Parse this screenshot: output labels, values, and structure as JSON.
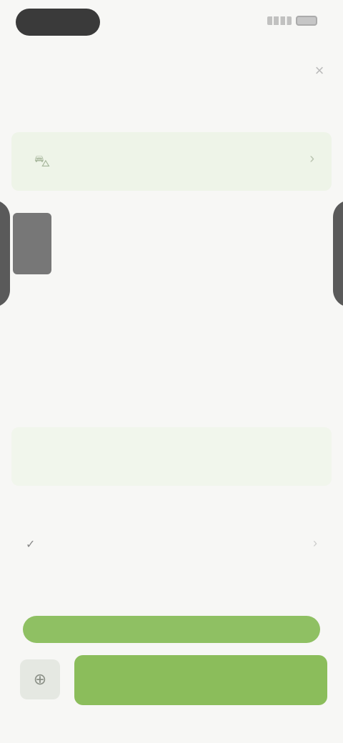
{
  "status_bar": {
    "time": "",
    "signal_icon": "signal-icon",
    "battery_icon": "battery-icon"
  },
  "header": {
    "title": "",
    "close_icon": "×"
  },
  "section_one": {
    "label": ""
  },
  "selector": {
    "value": "",
    "icon": "car-icon",
    "chevron": "›"
  },
  "profile": {
    "name": "",
    "description": "",
    "more_link": ""
  },
  "section_two": {
    "title": "",
    "text": "",
    "more_link": ""
  },
  "payment_card": {
    "text": "",
    "action_label": ""
  },
  "section_three": {
    "label": ""
  },
  "list_row": {
    "icon": "✓",
    "label": "",
    "chevron": "›"
  },
  "section_four": {
    "label": ""
  },
  "long_bar": {
    "label": ""
  },
  "bottom": {
    "left_icon": "⊕",
    "main_label": ""
  },
  "colors": {
    "accent_green": "#8bbd5b",
    "link_purple": "#9b7ce8",
    "panel_green": "#eef4e8"
  }
}
